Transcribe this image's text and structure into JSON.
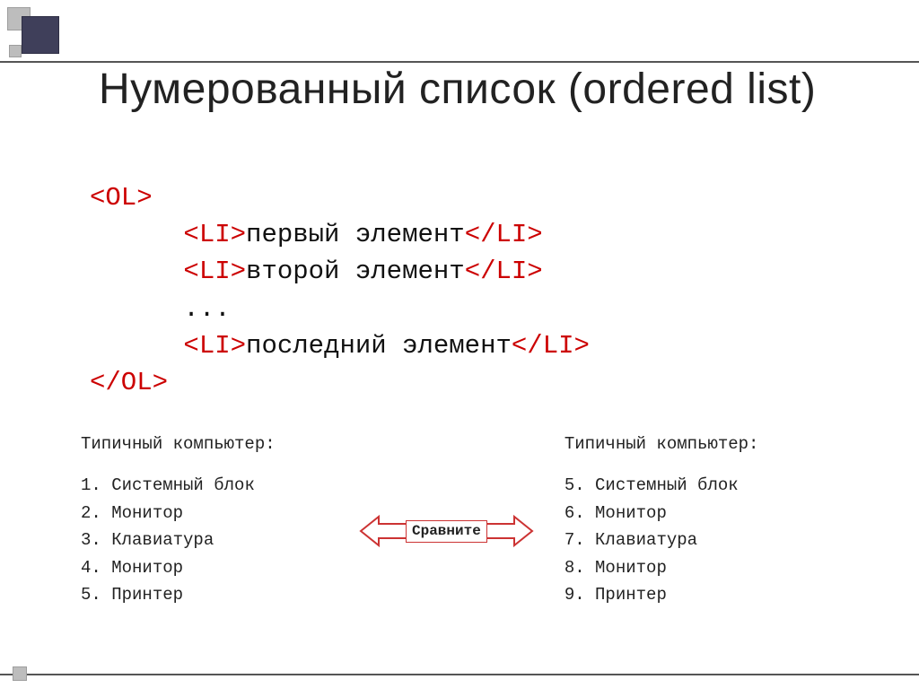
{
  "title": "Нумерованный список (ordered list)",
  "code": {
    "open": "<OL>",
    "li_open": "<LI>",
    "li_close": "</LI>",
    "line1": "первый элемент",
    "line2": "второй элемент",
    "ell": "...",
    "line3": "последний элемент",
    "close": "</OL>"
  },
  "compare_label": "Сравните",
  "left": {
    "header": "Типичный компьютер:",
    "start": 1,
    "items": [
      "Системный блок",
      "Монитор",
      "Клавиатура",
      "Монитор",
      "Принтер"
    ]
  },
  "right": {
    "header": "Типичный компьютер:",
    "start": 5,
    "items": [
      "Системный блок",
      "Монитор",
      "Клавиатура",
      "Монитор",
      "Принтер"
    ]
  }
}
